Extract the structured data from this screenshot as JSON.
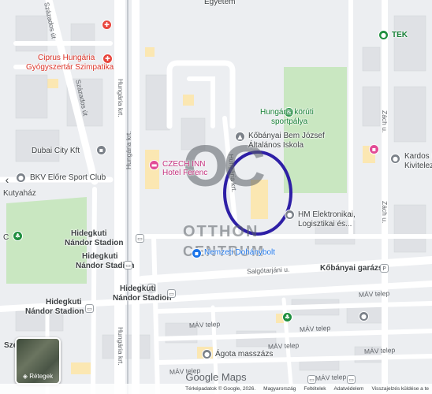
{
  "map": {
    "places": {
      "egyetem": "Egyetem",
      "ciprus_1": "Ciprus Hungária",
      "ciprus_2": "Gyógyszertár Szimpatika",
      "tek": "TEK",
      "hungaria_park_1": "Hungária körúti",
      "hungaria_park_2": "sportpálya",
      "school_1": "Kőbányai Bem József",
      "school_2": "Általános Iskola",
      "dubai": "Dubai City Kft",
      "czech_1": "CZECH INN",
      "czech_2": "Hotel Ferenc",
      "kardos_1": "Kardos I",
      "kardos_2": "Kivitelez",
      "bkv": "BKV Előre Sport Club",
      "kutyahaz": "Kutyaház",
      "hm_1": "HM Elektronikai,",
      "hm_2": "Logisztikai és...",
      "hidegkuti_1a": "Hidegkuti",
      "hidegkuti_1b": "Nándor Stadion",
      "hidegkuti_2a": "Hidegkuti",
      "hidegkuti_2b": "Nándor Stadion",
      "hidegkuti_3a": "Hidegkuti",
      "hidegkuti_3b": "Nándor Stadion",
      "hidegkuti_4a": "Hidegkuti",
      "hidegkuti_4b": "Nándor Stadion",
      "dohanybolt": "Nemzeti Dohánybolt",
      "kobanyai_garazs": "Kőbányai garázs",
      "agota": "Ágota masszázs",
      "sze": "Sze"
    },
    "roads": {
      "szazados_1": "Százados út",
      "szazados_2": "Százados út",
      "hungaria_1": "Hungária krt.",
      "hungaria_2": "Hungária krt.",
      "hungaria_3": "Hungária krt.",
      "hungaria_inner": "Hungária krt.",
      "zach_1": "Zách u.",
      "zach_2": "Zách u.",
      "salgotarjani": "Salgótarjáni u.",
      "mav_1": "MÁV telep",
      "mav_2": "MÁV telep",
      "mav_3": "MÁV telep",
      "mav_4": "MÁV telep",
      "mav_5": "MÁV telep",
      "mav_6": "MÁV telep",
      "mav_7": "MÁV telep"
    },
    "watermark": {
      "mark": "OC",
      "line1": "OTTHON",
      "line2": "CENTRUM"
    },
    "layers_label": "Rétegek",
    "logo": "Google Maps",
    "footer": {
      "imagery": "Térképadatok © Google, 2026.",
      "country": "Magyarország",
      "terms": "Feltételek",
      "privacy": "Adatvédelem",
      "feedback": "Visszajelzés küldése a te"
    },
    "colors": {
      "park": "#cfe8c8",
      "highlight_circle": "#2e1fa6",
      "road": "#ffffff",
      "building": "#fbe7b2"
    }
  }
}
